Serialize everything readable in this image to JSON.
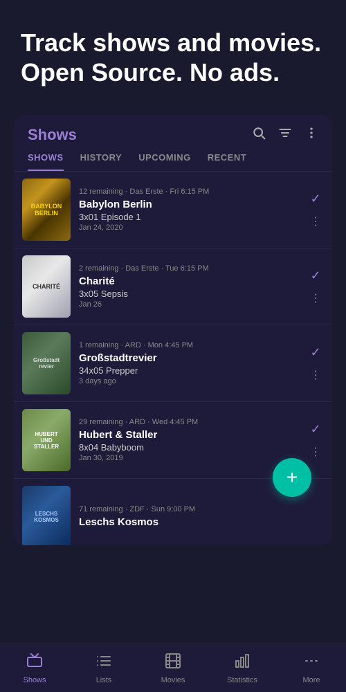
{
  "hero": {
    "title": "Track shows and movies. Open Source. No ads."
  },
  "card": {
    "title": "Shows",
    "icons": {
      "search": "🔍",
      "filter": "≡",
      "more": "⋮"
    }
  },
  "tabs": [
    {
      "label": "SHOWS",
      "active": true
    },
    {
      "label": "HISTORY",
      "active": false
    },
    {
      "label": "UPCOMING",
      "active": false
    },
    {
      "label": "RECENT",
      "active": false
    }
  ],
  "shows": [
    {
      "id": 1,
      "poster_text": "BABYLON\nBERLIN",
      "poster_class": "poster-babylon",
      "meta": "12 remaining · Das Erste · Fri 6:15 PM",
      "name": "Babylon Berlin",
      "episode": "3x01 Episode 1",
      "date": "Jan 24, 2020",
      "has_check": true
    },
    {
      "id": 2,
      "poster_text": "CHARITÉ",
      "poster_class": "poster-charite",
      "meta": "2 remaining · Das Erste · Tue 6:15 PM",
      "name": "Charité",
      "episode": "3x05 Sepsis",
      "date": "Jan 26",
      "has_check": true
    },
    {
      "id": 3,
      "poster_text": "Großstadt\nrevier",
      "poster_class": "poster-gross",
      "meta": "1 remaining · ARD · Mon 4:45 PM",
      "name": "Großstadtrevier",
      "episode": "34x05 Prepper",
      "date": "3 days ago",
      "has_check": true
    },
    {
      "id": 4,
      "poster_text": "HUBERT\nUND\nSTALLER",
      "poster_class": "poster-hubert",
      "meta": "29 remaining · ARD · Wed 4:45 PM",
      "name": "Hubert & Staller",
      "episode": "8x04 Babyboom",
      "date": "Jan 30, 2019",
      "has_check": true
    },
    {
      "id": 5,
      "poster_text": "LESCHS\nKOSMOS",
      "poster_class": "poster-leschs",
      "meta": "71 remaining · ZDF · Sun 9:00 PM",
      "name": "Leschs Kosmos",
      "episode": "",
      "date": "",
      "has_check": false
    }
  ],
  "fab": {
    "label": "+"
  },
  "bottom_nav": [
    {
      "id": "shows",
      "icon": "tv",
      "label": "Shows",
      "active": true
    },
    {
      "id": "lists",
      "icon": "list",
      "label": "Lists",
      "active": false
    },
    {
      "id": "movies",
      "icon": "movie",
      "label": "Movies",
      "active": false
    },
    {
      "id": "statistics",
      "icon": "bar_chart",
      "label": "Statistics",
      "active": false
    },
    {
      "id": "more",
      "icon": "more_horiz",
      "label": "More",
      "active": false
    }
  ]
}
